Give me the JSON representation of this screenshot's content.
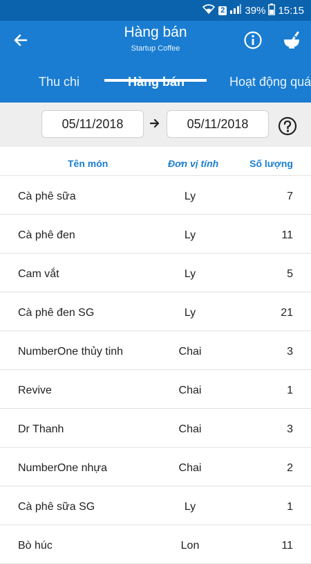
{
  "status_bar": {
    "badge": "2",
    "battery": "39%",
    "time": "15:15"
  },
  "header": {
    "title": "Hàng bán",
    "subtitle": "Startup Coffee"
  },
  "tabs": [
    {
      "label": "Thu chi"
    },
    {
      "label": "Hàng bán",
      "active": true
    },
    {
      "label": "Hoạt động quá"
    }
  ],
  "date_range": {
    "from": "05/11/2018",
    "to": "05/11/2018"
  },
  "table": {
    "headers": {
      "name": "Tên món",
      "unit": "Đơn vị tính",
      "qty": "Số lượng"
    },
    "rows": [
      {
        "name": "Cà phê sữa",
        "unit": "Ly",
        "qty": "7"
      },
      {
        "name": "Cà phê đen",
        "unit": "Ly",
        "qty": "11"
      },
      {
        "name": "Cam vắt",
        "unit": "Ly",
        "qty": "5"
      },
      {
        "name": "Cà phê đen SG",
        "unit": "Ly",
        "qty": "21"
      },
      {
        "name": "NumberOne thủy tinh",
        "unit": "Chai",
        "qty": "3"
      },
      {
        "name": "Revive",
        "unit": "Chai",
        "qty": "1"
      },
      {
        "name": "Dr Thanh",
        "unit": "Chai",
        "qty": "3"
      },
      {
        "name": "NumberOne nhựa",
        "unit": "Chai",
        "qty": "2"
      },
      {
        "name": "Cà phê sữa SG",
        "unit": "Ly",
        "qty": "1"
      },
      {
        "name": "Bò húc",
        "unit": "Lon",
        "qty": "11"
      }
    ]
  },
  "colors": {
    "primary": "#1a7dd1",
    "status_bar": "#0c63ad",
    "date_bar": "#eeeeee"
  },
  "icons": {
    "back": "arrow-left-icon",
    "info": "info-icon",
    "bowl": "mortar-bowl-icon",
    "help": "help-circle-icon",
    "date_arrow": "arrow-right-icon"
  }
}
